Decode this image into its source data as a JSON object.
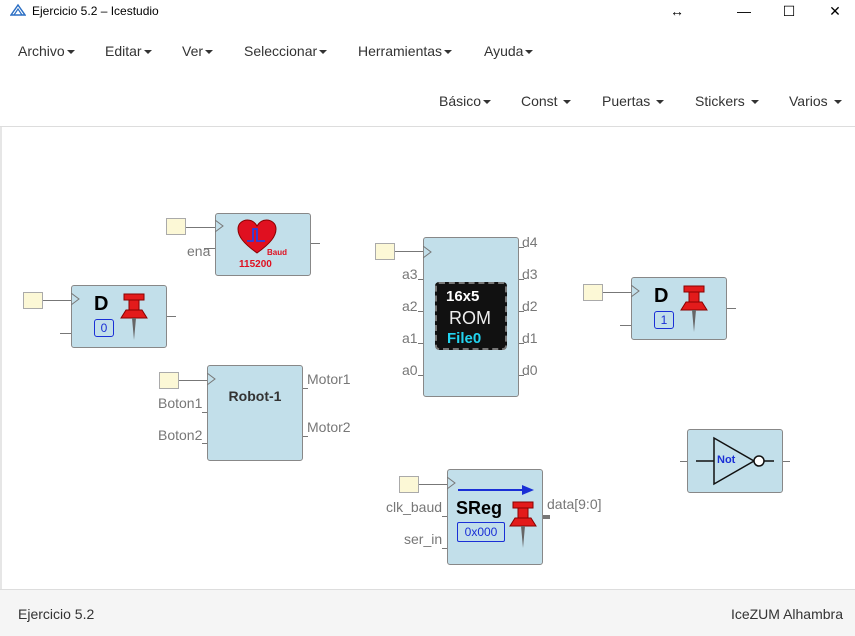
{
  "window": {
    "title": "Ejercicio 5.2 – Icestudio",
    "resize_glyph": "↔",
    "minimize_glyph": "—",
    "maximize_glyph": "☐",
    "close_glyph": "✕"
  },
  "menu": [
    "Archivo",
    "Editar",
    "Ver",
    "Seleccionar",
    "Herramientas",
    "Ayuda"
  ],
  "toolbar": [
    "Básico",
    "Const",
    "Puertas",
    "Stickers",
    "Varios"
  ],
  "blocks": {
    "baud": {
      "label": "Baud",
      "value": "115200",
      "input_label": "ena"
    },
    "dff0": {
      "name": "D",
      "init": "0"
    },
    "dff1": {
      "name": "D",
      "init": "1"
    },
    "robot": {
      "name": "Robot-1",
      "inputs": [
        "Boton1",
        "Boton2"
      ],
      "outputs": [
        "Motor1",
        "Motor2"
      ]
    },
    "rom": {
      "line1": "16x5",
      "line2": "ROM",
      "line3": "File0",
      "inputs": [
        "a3",
        "a2",
        "a1",
        "a0"
      ],
      "outputs": [
        "d4",
        "d3",
        "d2",
        "d1",
        "d0"
      ]
    },
    "sreg": {
      "name": "SReg",
      "init": "0x000",
      "inputs": [
        "clk_baud",
        "ser_in"
      ],
      "output": "data[9:0]"
    },
    "not": {
      "name": "Not"
    }
  },
  "footer": {
    "left": "Ejercicio 5.2",
    "right": "IceZUM Alhambra"
  },
  "colors": {
    "block": "#c2dfea",
    "pin": "#fcf8d6",
    "pushpin": "#e31b1b",
    "heart": "#e01020",
    "rom_text_cyan": "#22d4f0",
    "not_label": "#1a2fd6"
  }
}
